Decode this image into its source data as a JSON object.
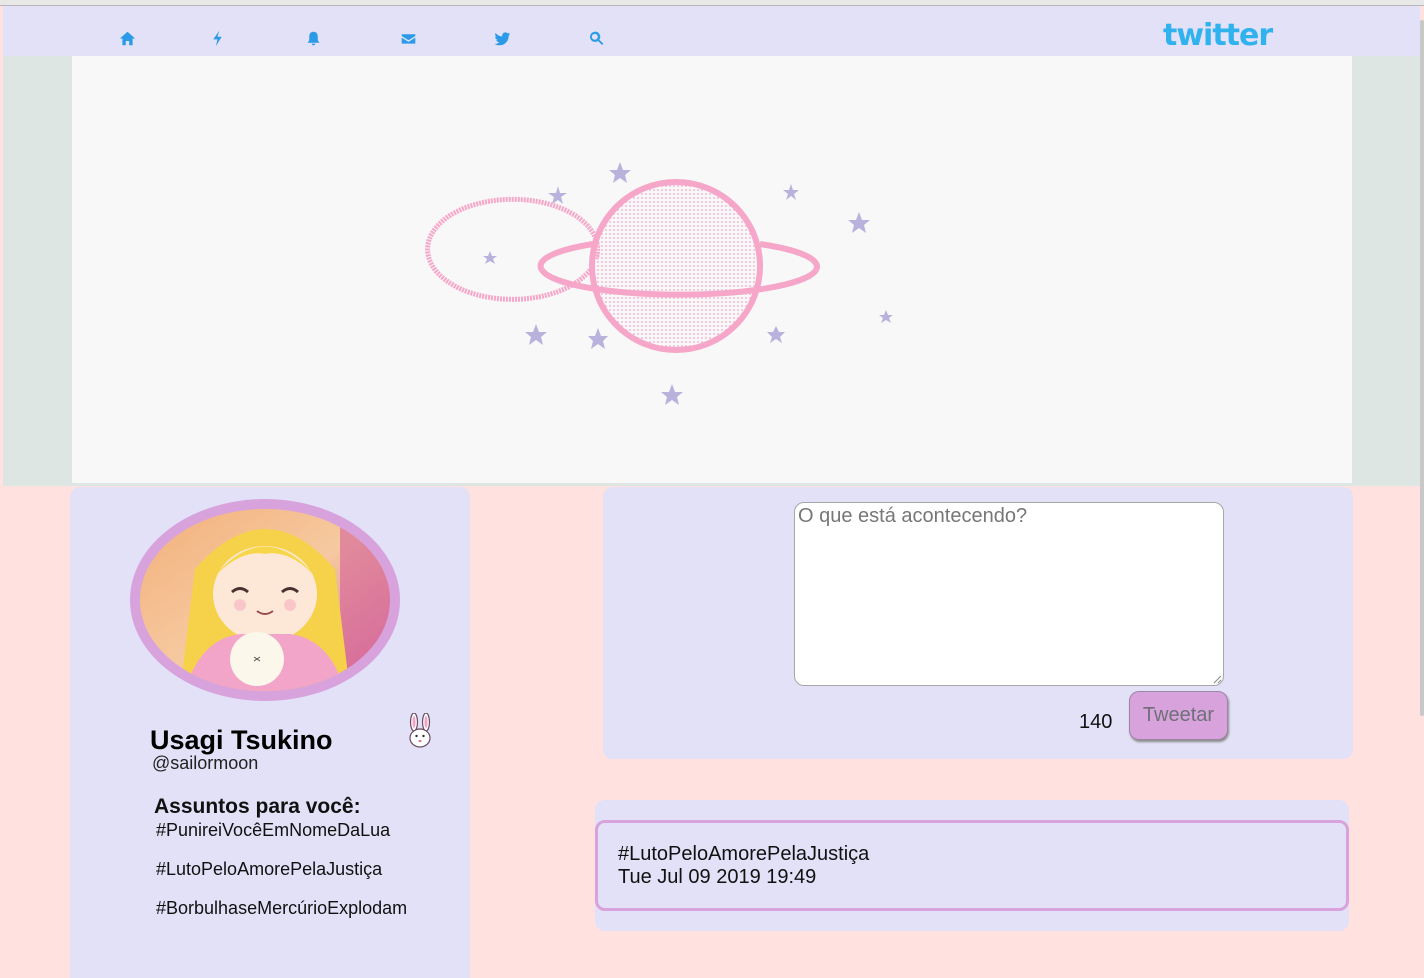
{
  "navbar": {
    "icons": [
      "home-icon",
      "lightning-icon",
      "bell-icon",
      "envelope-icon",
      "twitter-bird-icon",
      "search-icon"
    ],
    "logo": "twitter"
  },
  "profile": {
    "name": "Usagi Tsukino",
    "handle": "@sailormoon",
    "topics_title": "Assuntos para você:",
    "topics": [
      "#PunireiVocêEmNomeDaLua",
      "#LutoPeloAmorePelaJustiça",
      "#BorbulhaseMercúrioExplodam"
    ]
  },
  "compose": {
    "placeholder": "O que está acontecendo?",
    "value": "",
    "counter": "140",
    "button_label": "Tweetar"
  },
  "feed": {
    "tweets": [
      {
        "text": "#LutoPeloAmorePelaJustiça",
        "time": "Tue Jul 09 2019 19:49"
      }
    ]
  },
  "colors": {
    "accent": "#2b9be8",
    "lavender": "#e2e1f7",
    "pink_bg": "#ffe1df",
    "mint_bg": "#dde6e3",
    "orchid": "#d8a3dd",
    "planet": "#f6a6c8",
    "stars": "#b8b2dd"
  }
}
